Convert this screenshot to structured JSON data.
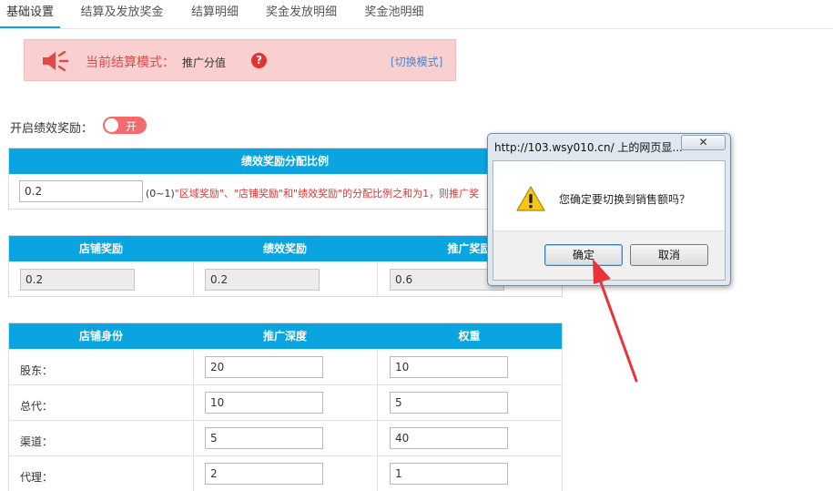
{
  "tabs": [
    {
      "label": "基础设置",
      "active": true
    },
    {
      "label": "结算及发放奖金",
      "active": false
    },
    {
      "label": "结算明细",
      "active": false
    },
    {
      "label": "奖金发放明细",
      "active": false
    },
    {
      "label": "奖金池明细",
      "active": false
    }
  ],
  "banner": {
    "label": "当前结算模式：",
    "value": "推广分值",
    "help_icon": "?",
    "switch_link": "[切换模式]"
  },
  "performance": {
    "label": "开启绩效奖励：",
    "toggle_text": "开",
    "enabled": true
  },
  "ratio_table": {
    "header": "绩效奖励分配比例",
    "value": "0.2",
    "note_prefix": "(0~1)",
    "note_red": "\"区域奖励\"、\"店铺奖励\"和\"绩效奖励\"的分配比例之和为1，则推广奖"
  },
  "reward_table": {
    "headers": [
      "店铺奖励",
      "绩效奖励",
      "推广奖励"
    ],
    "values": [
      "0.2",
      "0.2",
      "0.6"
    ]
  },
  "identity_table": {
    "headers": [
      "店铺身份",
      "推广深度",
      "权重"
    ],
    "rows": [
      {
        "label": "股东：",
        "depth": "20",
        "weight": "10"
      },
      {
        "label": "总代：",
        "depth": "10",
        "weight": "5"
      },
      {
        "label": "渠道：",
        "depth": "5",
        "weight": "40"
      },
      {
        "label": "代理：",
        "depth": "2",
        "weight": "1"
      }
    ]
  },
  "dialog": {
    "title": "http://103.wsy010.cn/ 上的网页显...",
    "close_label": "✕",
    "message": "您确定要切换到销售额吗？",
    "ok_label": "确定",
    "cancel_label": "取消"
  },
  "colors": {
    "accent": "#0aa5e0",
    "banner_bg": "#f9cfcf",
    "toggle_on": "#f56b6b",
    "arrow": "#e8333a"
  }
}
